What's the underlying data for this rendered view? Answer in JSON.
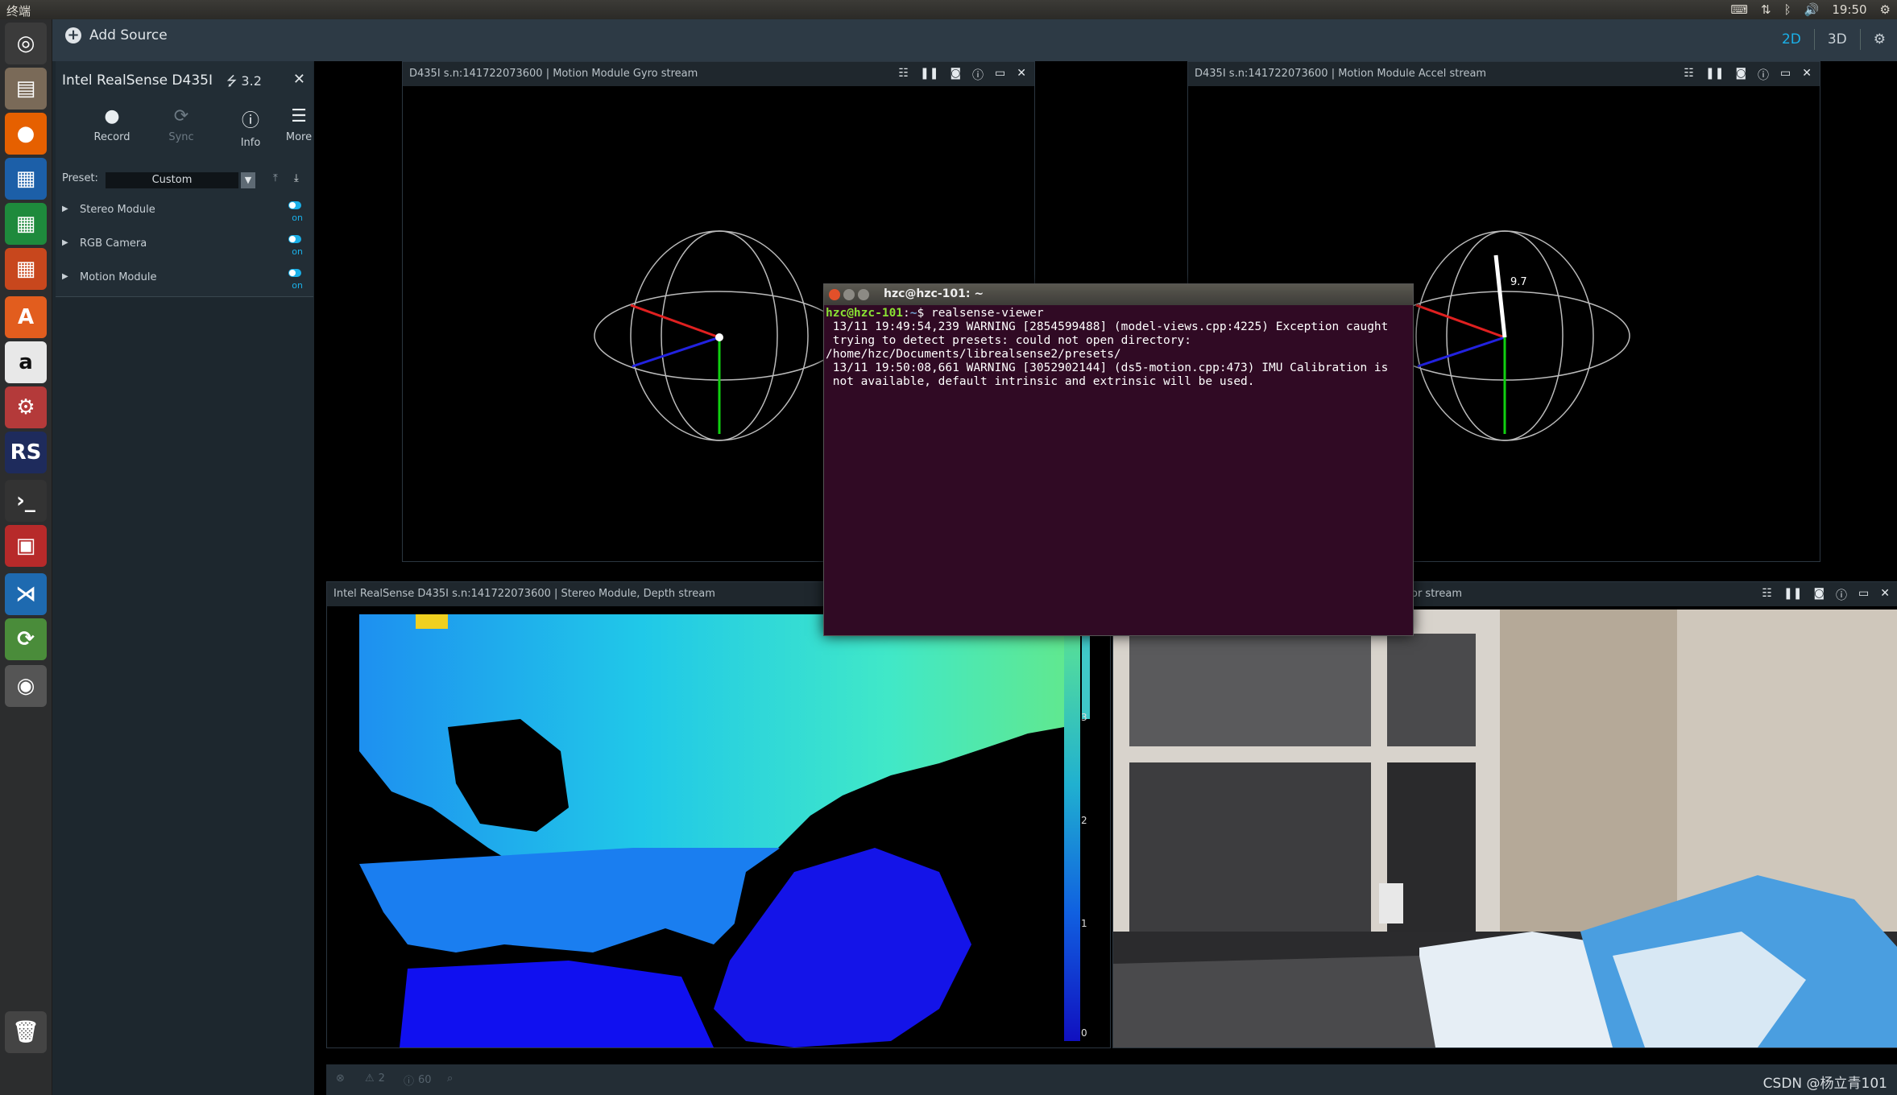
{
  "system": {
    "title": "终端",
    "time": "19:50"
  },
  "launcher": [
    {
      "name": "ubuntu-dash-icon",
      "glyph": "◎",
      "bg": "#3b3b3b"
    },
    {
      "name": "files-icon",
      "glyph": "▤",
      "bg": "#7a6a58"
    },
    {
      "name": "firefox-icon",
      "glyph": "●",
      "bg": "#e66000"
    },
    {
      "name": "writer-icon",
      "glyph": "▦",
      "bg": "#1c5fa8"
    },
    {
      "name": "calc-icon",
      "glyph": "▦",
      "bg": "#1e8a3c"
    },
    {
      "name": "impress-icon",
      "glyph": "▦",
      "bg": "#c8471d"
    },
    {
      "name": "software-center-icon",
      "glyph": "A",
      "bg": "#e25d1e"
    },
    {
      "name": "amazon-icon",
      "glyph": "a",
      "bg": "#e8e8e8"
    },
    {
      "name": "system-settings-icon",
      "glyph": "⚙",
      "bg": "#b43a3a"
    },
    {
      "name": "realsense-icon",
      "glyph": "RS",
      "bg": "#1e2b5c"
    },
    {
      "name": "terminal-icon",
      "glyph": "›_",
      "bg": "#333333"
    },
    {
      "name": "workspace-icon",
      "glyph": "▣",
      "bg": "#b72a2a"
    },
    {
      "name": "vscode-icon",
      "glyph": "⋊",
      "bg": "#1e6ab0"
    },
    {
      "name": "update-icon",
      "glyph": "⟳",
      "bg": "#4a8c3a"
    },
    {
      "name": "dvd-icon",
      "glyph": "◉",
      "bg": "#555555"
    },
    {
      "name": "trash-icon",
      "glyph": "🗑",
      "bg": "#444444"
    }
  ],
  "header": {
    "add_source": "Add Source",
    "view_2d": "2D",
    "view_3d": "3D"
  },
  "device": {
    "name": "Intel RealSense D435I",
    "usb": "3.2",
    "toolbar": [
      {
        "label": "Record",
        "icon": "●",
        "enabled": true
      },
      {
        "label": "Sync",
        "icon": "⟳",
        "enabled": false
      },
      {
        "label": "Info",
        "icon": "ⓘ",
        "enabled": true
      },
      {
        "label": "More",
        "icon": "☰",
        "enabled": true
      }
    ],
    "preset_label": "Preset:",
    "preset_value": "Custom",
    "modules": [
      {
        "name": "Stereo Module",
        "state": "on"
      },
      {
        "name": "RGB Camera",
        "state": "on"
      },
      {
        "name": "Motion Module",
        "state": "on"
      }
    ]
  },
  "streams": {
    "gyro": {
      "title": "D435I s.n:141722073600 | Motion Module Gyro stream"
    },
    "accel": {
      "title": "D435I s.n:141722073600 | Motion Module Accel stream",
      "readout": "9.7"
    },
    "depth": {
      "title": "Intel RealSense D435I s.n:141722073600 | Stereo Module, Depth stream",
      "scale": [
        "3",
        "2",
        "1",
        "0"
      ]
    },
    "color": {
      "title": "or stream"
    }
  },
  "status": {
    "warnings": "2",
    "info": "60",
    "watermark": "CSDN @杨立青101"
  },
  "terminal": {
    "title": "hzc@hzc-101: ~",
    "prompt_user": "hzc@hzc-101",
    "prompt_path": "~",
    "command": "realsense-viewer",
    "output": " 13/11 19:49:54,239 WARNING [2854599488] (model-views.cpp:4225) Exception caught\n trying to detect presets: could not open directory: /home/hzc/Documents/librealsense2/presets/\n 13/11 19:50:08,661 WARNING [3052902144] (ds5-motion.cpp:473) IMU Calibration is\n not available, default intrinsic and extrinsic will be used."
  }
}
